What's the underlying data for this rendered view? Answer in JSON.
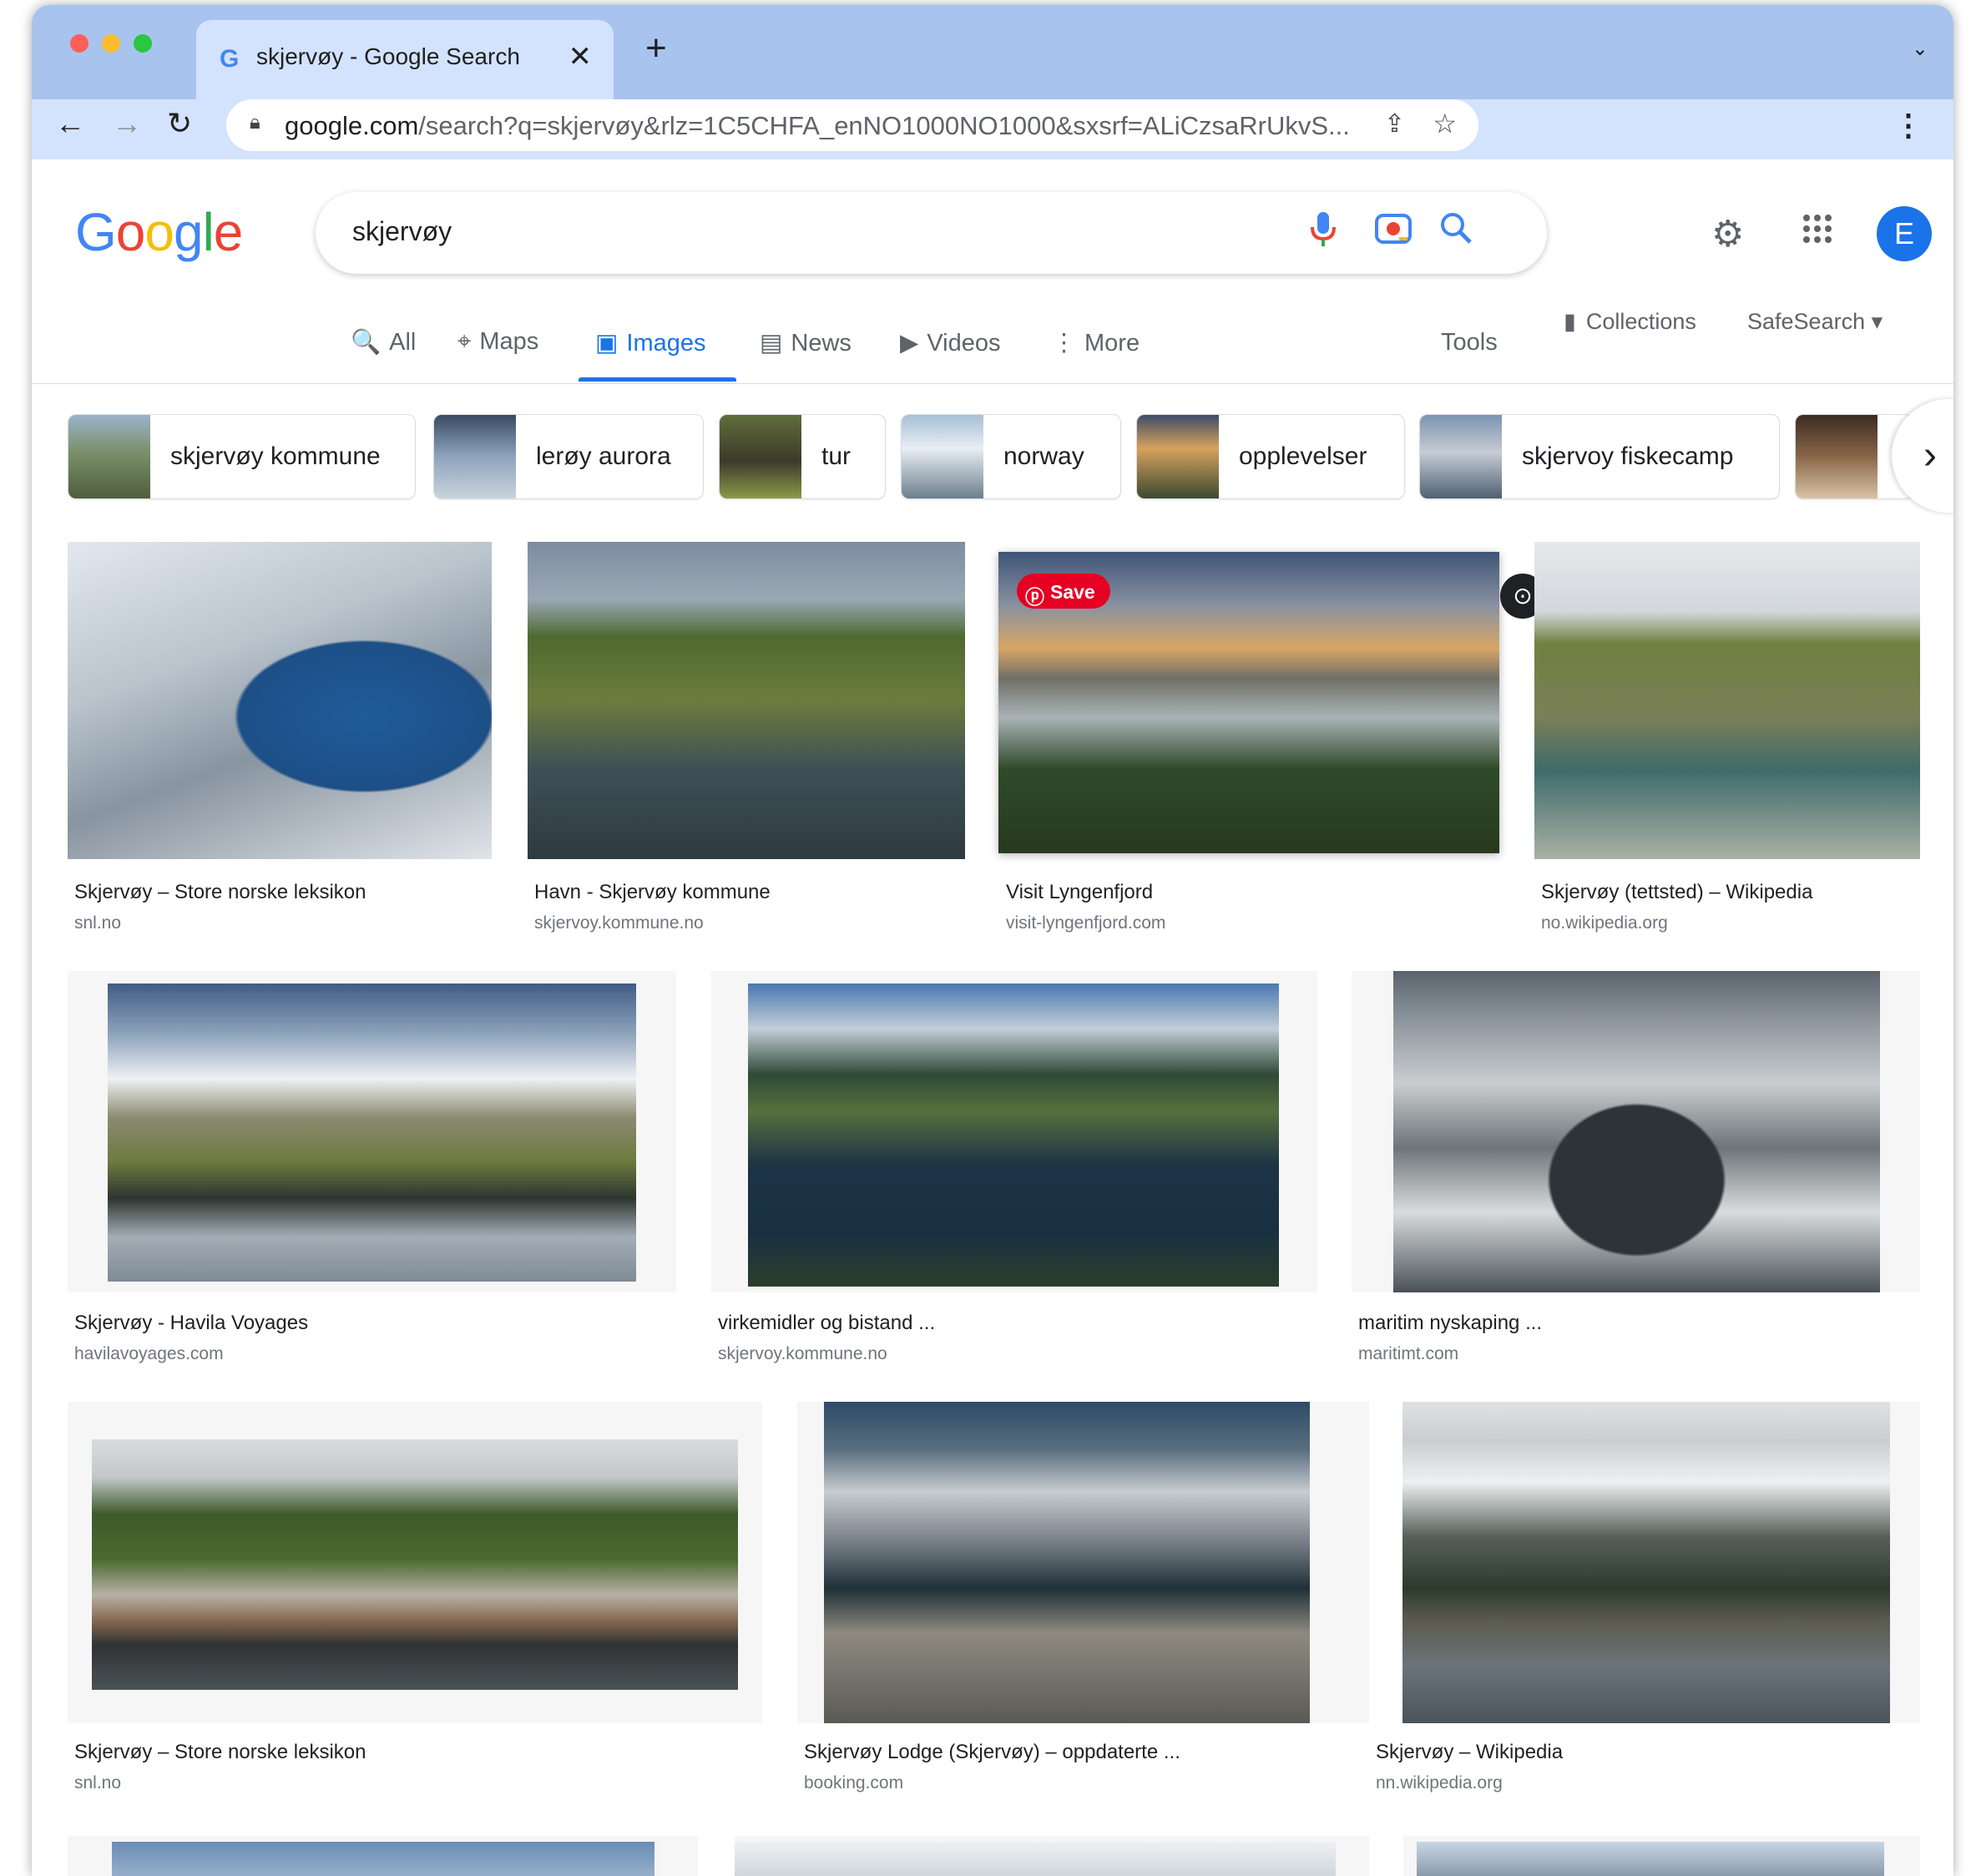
{
  "browser": {
    "tab_title": "skjervøy - Google Search",
    "tab_close": "✕",
    "new_tab": "+",
    "url_host": "google.com",
    "url_rest": "/search?q=skjervøy&rlz=1C5CHFA_enNO1000NO1000&sxsrf=ALiCzsaRrUkvS..."
  },
  "google": {
    "logo_letters": [
      "G",
      "o",
      "o",
      "g",
      "l",
      "e"
    ],
    "logo_colors": [
      "#4285f4",
      "#ea4335",
      "#fbbc05",
      "#4285f4",
      "#34a853",
      "#ea4335"
    ],
    "query": "skjervøy",
    "avatar_letter": "E"
  },
  "search_tabs": [
    {
      "label": "All",
      "icon": "🔍"
    },
    {
      "label": "Maps",
      "icon": "⌖"
    },
    {
      "label": "Images",
      "icon": "▣"
    },
    {
      "label": "News",
      "icon": "▤"
    },
    {
      "label": "Videos",
      "icon": "▶"
    },
    {
      "label": "More",
      "icon": "⋮"
    }
  ],
  "tools_label": "Tools",
  "collections_label": "Collections",
  "safesearch_label": "SafeSearch ▾",
  "chips": [
    {
      "label": "skjervøy kommune"
    },
    {
      "label": "lerøy aurora"
    },
    {
      "label": "tur"
    },
    {
      "label": "norway"
    },
    {
      "label": "opplevelser"
    },
    {
      "label": "skjervoy fiskecamp"
    },
    {
      "label": ""
    }
  ],
  "save_label": "Save",
  "results": [
    {
      "caption": "Skjervøy – Store norske leksikon",
      "source": "snl.no"
    },
    {
      "caption": "Havn - Skjervøy kommune",
      "source": "skjervoy.kommune.no"
    },
    {
      "caption": "Visit Lyngenfjord",
      "source": "visit-lyngenfjord.com"
    },
    {
      "caption": "Skjervøy (tettsted) – Wikipedia",
      "source": "no.wikipedia.org"
    },
    {
      "caption": "Skjervøy - Havila Voyages",
      "source": "havilavoyages.com"
    },
    {
      "caption": "virkemidler og bistand ...",
      "source": "skjervoy.kommune.no"
    },
    {
      "caption": "maritim nyskaping ...",
      "source": "maritimt.com"
    },
    {
      "caption": "Skjervøy – Store norske leksikon",
      "source": "snl.no"
    },
    {
      "caption": "Skjervøy Lodge (Skjervøy) – oppdaterte ...",
      "source": "booking.com"
    },
    {
      "caption": "Skjervøy – Wikipedia",
      "source": "nn.wikipedia.org"
    }
  ]
}
